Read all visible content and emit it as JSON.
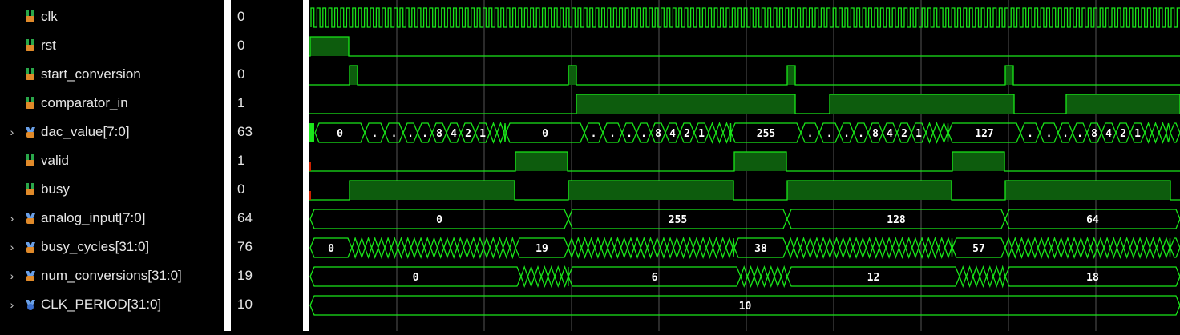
{
  "signals": [
    {
      "name": "clk",
      "value": "0",
      "kind": "bit",
      "expandable": false
    },
    {
      "name": "rst",
      "value": "0",
      "kind": "bit",
      "expandable": false
    },
    {
      "name": "start_conversion",
      "value": "0",
      "kind": "bit",
      "expandable": false
    },
    {
      "name": "comparator_in",
      "value": "1",
      "kind": "bit",
      "expandable": false
    },
    {
      "name": "dac_value[7:0]",
      "value": "63",
      "kind": "bus",
      "expandable": true
    },
    {
      "name": "valid",
      "value": "1",
      "kind": "bit",
      "expandable": false
    },
    {
      "name": "busy",
      "value": "0",
      "kind": "bit",
      "expandable": false
    },
    {
      "name": "analog_input[7:0]",
      "value": "64",
      "kind": "bus",
      "expandable": true
    },
    {
      "name": "busy_cycles[31:0]",
      "value": "76",
      "kind": "bus",
      "expandable": true
    },
    {
      "name": "num_conversions[31:0]",
      "value": "19",
      "kind": "bus",
      "expandable": true
    },
    {
      "name": "CLK_PERIOD[31:0]",
      "value": "10",
      "kind": "param",
      "expandable": true
    }
  ],
  "wave_labels": {
    "dac_value": [
      "0",
      ".",
      ".",
      ".",
      ".",
      "8",
      "4",
      "2",
      "1",
      "0",
      ".",
      ".",
      ".",
      ".",
      "8",
      "4",
      "2",
      "1",
      "255",
      ".",
      ".",
      ".",
      ".",
      "8",
      "4",
      "2",
      "1",
      "127",
      ".",
      ".",
      ".",
      ".",
      "8",
      "4",
      "2",
      "1"
    ],
    "analog_input": [
      "0",
      "255",
      "128",
      "64"
    ],
    "busy_cycles": [
      "0",
      "19",
      "38",
      "57"
    ],
    "num_conversions": [
      "0",
      "6",
      "12",
      "18"
    ],
    "clk_period": [
      "10"
    ]
  },
  "colors": {
    "waveform": "#19e619",
    "fill": "#0d5c0d",
    "grid": "#555555",
    "background": "#000000",
    "text": "#e6e6e6",
    "cursor_marker": "#cc2200",
    "separator": "#ffffff"
  }
}
